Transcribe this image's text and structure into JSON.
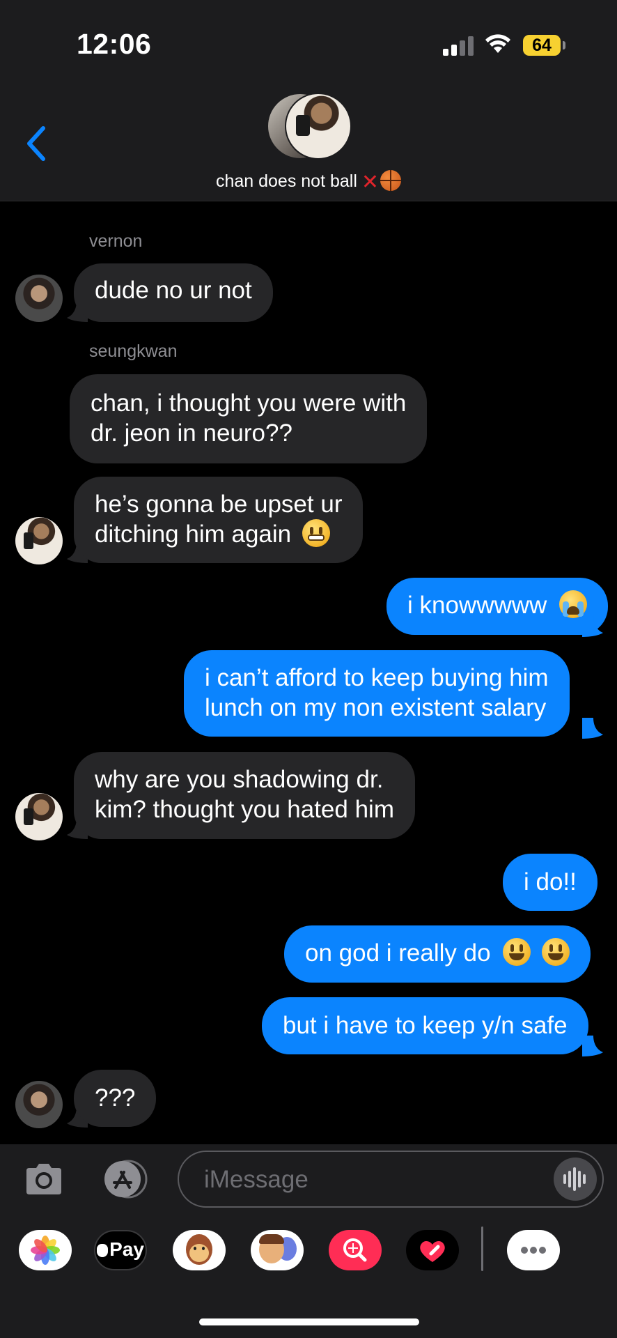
{
  "status_bar": {
    "time": "12:06",
    "battery": "64"
  },
  "header": {
    "group_name": "chan does not ball"
  },
  "messages": [
    {
      "type": "received",
      "sender": "vernon",
      "text": "dude no ur not"
    },
    {
      "type": "received",
      "sender": "seungkwan",
      "lines": [
        "chan, i thought you were with",
        "dr. jeon in neuro??"
      ]
    },
    {
      "type": "received",
      "lines": [
        "he’s gonna be upset ur",
        "ditching him again"
      ],
      "emoji": "grimacing-face"
    },
    {
      "type": "sent",
      "text": "i knowwwww",
      "emoji": "loudly-crying-face"
    },
    {
      "type": "sent",
      "lines": [
        "i can’t afford to keep buying him",
        "lunch on my non existent salary"
      ]
    },
    {
      "type": "received",
      "lines": [
        "why are you shadowing dr.",
        "kim? thought you hated him"
      ]
    },
    {
      "type": "sent",
      "text": "i do!!"
    },
    {
      "type": "sent",
      "text": "on god i really do",
      "emoji": "grinning-face"
    },
    {
      "type": "sent",
      "text": "but i have to keep y/n safe"
    },
    {
      "type": "received",
      "text": "???"
    }
  ],
  "input": {
    "placeholder": "iMessage"
  },
  "app_drawer": {
    "apps": [
      "photos-app",
      "apple-pay",
      "animoji",
      "memoji-stickers",
      "search-images",
      "digital-touch",
      "more"
    ],
    "apple_pay_label": "Pay"
  },
  "colors": {
    "sent_bubble": "#0b84fe",
    "received_bubble": "#262628",
    "accent": "#0b84fe"
  }
}
